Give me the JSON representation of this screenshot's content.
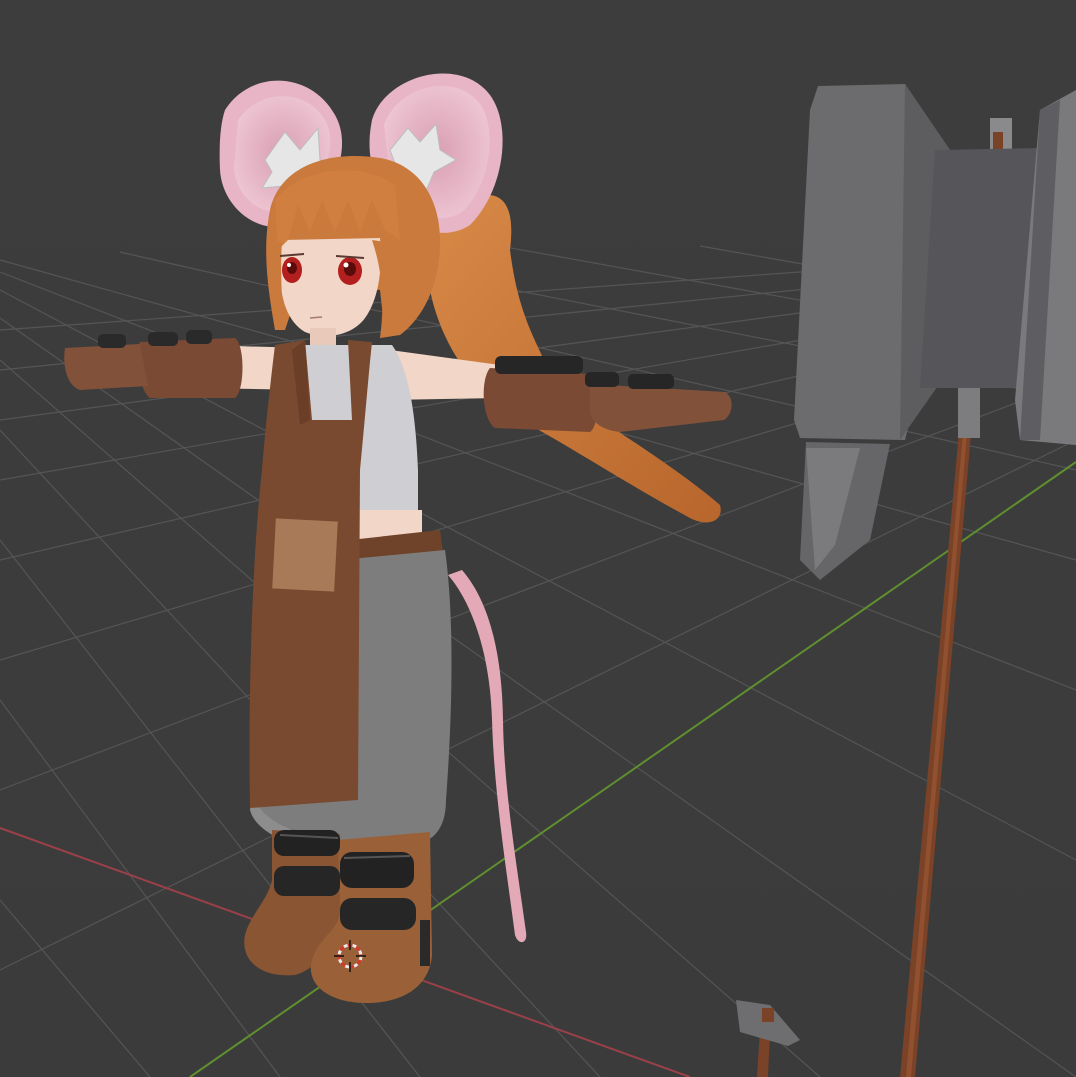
{
  "viewport": {
    "background": "#3d3d3d",
    "grid_color": "#5a5a5a",
    "x_axis_color": "#9a4048",
    "y_axis_color": "#5f8f2e"
  },
  "scene": {
    "character": {
      "hair_color": "#c97a3c",
      "skin_color": "#f2d6c8",
      "ear_color": "#e8b5c6",
      "apron_color": "#7a4a30",
      "shirt_color": "#cfcfd3",
      "pants_color": "#7d7d7d",
      "boot_color": "#8a5532",
      "glove_color": "#7a4a34",
      "tail_color": "#e3a9b7"
    },
    "weapon": {
      "head_color": "#6e6e70",
      "handle_color": "#7a4226"
    },
    "small_hammer": {
      "head_color": "#6e6e70",
      "handle_color": "#7a4226"
    },
    "origin_cursor_icon": "3d-cursor-icon"
  }
}
